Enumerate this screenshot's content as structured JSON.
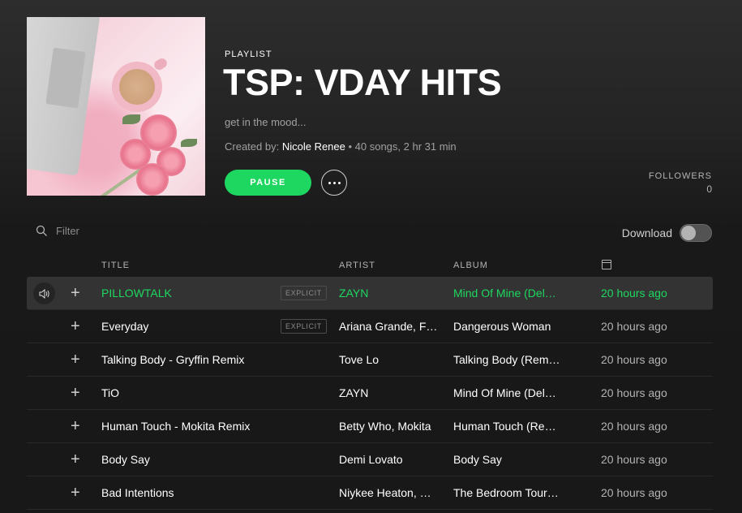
{
  "header": {
    "type_label": "PLAYLIST",
    "title": "TSP: VDAY HITS",
    "description": "get in the mood...",
    "created_by_label": "Created by:",
    "owner": "Nicole Renee",
    "summary": " • 40 songs, 2 hr 31 min",
    "pause_label": "PAUSE",
    "followers_label": "FOLLOWERS",
    "followers_count": "0"
  },
  "toolbar": {
    "filter_placeholder": "Filter",
    "download_label": "Download",
    "download_enabled": false
  },
  "columns": {
    "title": "TITLE",
    "artist": "ARTIST",
    "album": "ALBUM"
  },
  "tracks": [
    {
      "title": "PILLOWTALK",
      "explicit": "EXPLICIT",
      "artist": "ZAYN",
      "album": "Mind Of Mine (Del…",
      "added": "20 hours ago",
      "playing": true
    },
    {
      "title": "Everyday",
      "explicit": "EXPLICIT",
      "artist": "Ariana Grande, Fut…",
      "album": "Dangerous Woman",
      "added": "20 hours ago"
    },
    {
      "title": "Talking Body - Gryffin Remix",
      "artist": "Tove Lo",
      "album": "Talking Body (Remi…",
      "added": "20 hours ago"
    },
    {
      "title": "TiO",
      "artist": "ZAYN",
      "album": "Mind Of Mine (Del…",
      "added": "20 hours ago"
    },
    {
      "title": "Human Touch - Mokita Remix",
      "artist": "Betty Who, Mokita",
      "album": "Human Touch (Re…",
      "added": "20 hours ago"
    },
    {
      "title": "Body Say",
      "artist": "Demi Lovato",
      "album": "Body Say",
      "added": "20 hours ago"
    },
    {
      "title": "Bad Intentions",
      "artist": "Niykee Heaton, Mi…",
      "album": "The Bedroom Tour…",
      "added": "20 hours ago"
    }
  ],
  "colors": {
    "accent": "#1ed760",
    "background": "#181818"
  }
}
